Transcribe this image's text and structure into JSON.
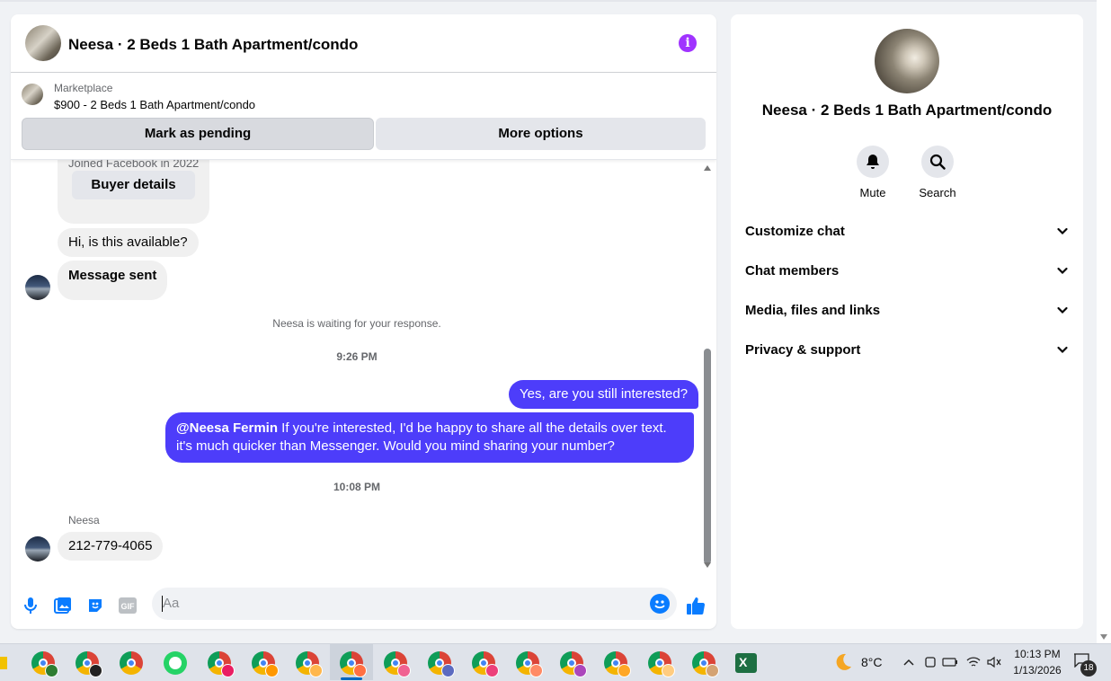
{
  "chat": {
    "title": "Neesa · 2 Beds 1 Bath Apartment/condo",
    "listing": {
      "label": "Marketplace",
      "item": "$900 - 2 Beds 1 Bath Apartment/condo"
    },
    "buttons": {
      "pending": "Mark as pending",
      "more": "More options"
    },
    "buyer_card": {
      "joined": "Joined Facebook in 2022",
      "details_button": "Buyer details"
    },
    "messages": [
      {
        "from": "them",
        "text": "Hi, is this available?"
      },
      {
        "from": "them",
        "text": "Message sent"
      },
      {
        "from": "system",
        "text": "Neesa is waiting for your response."
      },
      {
        "from": "timestamp",
        "text": "9:26 PM"
      },
      {
        "from": "me",
        "text": "Yes, are you still interested?"
      },
      {
        "from": "me",
        "mention": "@Neesa Fermin",
        "text": " If you're interested, I'd be happy to share all the details over text. it's much quicker than Messenger. Would you mind sharing your number?"
      },
      {
        "from": "timestamp",
        "text": "10:08 PM"
      },
      {
        "from": "sender",
        "text": "Neesa"
      },
      {
        "from": "them",
        "text": "212-779-4065"
      }
    ],
    "composer": {
      "placeholder": "Aa",
      "icons": [
        "microphone-icon",
        "image-icon",
        "sticker-icon",
        "gif-icon",
        "emoji-icon",
        "like-icon"
      ],
      "gif_label": "GIF"
    },
    "colors": {
      "outgoing_bubble": "#4d3dfa",
      "incoming_bubble": "#f0f0f0",
      "accent": "#0a7cff",
      "info_icon": "#a033ff"
    }
  },
  "info_panel": {
    "title": "Neesa · 2 Beds 1 Bath Apartment/condo",
    "actions": [
      {
        "label": "Mute",
        "icon": "bell-icon"
      },
      {
        "label": "Search",
        "icon": "search-icon"
      }
    ],
    "sections": [
      "Customize chat",
      "Chat members",
      "Media, files and links",
      "Privacy & support"
    ]
  },
  "taskbar": {
    "weather": "8°C",
    "time": "10:13 PM",
    "date": "1/13/2026",
    "notifications": "18"
  }
}
